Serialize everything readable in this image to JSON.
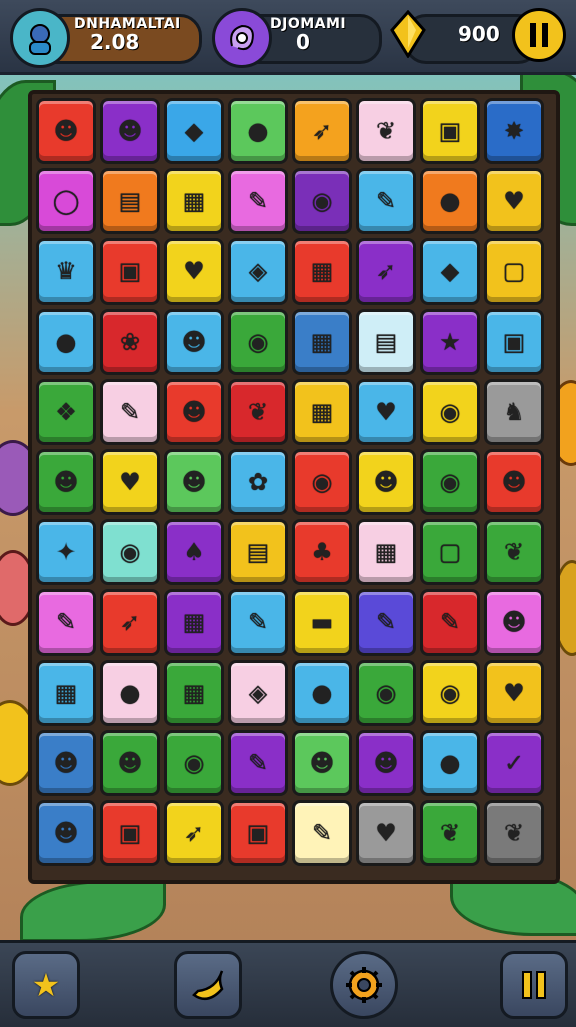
{
  "hud": {
    "player1": {
      "title": "DNHAMALTAI",
      "value": "2.08",
      "avatar_icon": "character-portrait-icon"
    },
    "player2": {
      "title": "DJOMAMI",
      "value": "0",
      "avatar_icon": "purple-creature-icon"
    },
    "currency": {
      "icon": "gold-gem-icon",
      "value": "900"
    },
    "pause_icon": "pause-icon"
  },
  "board": {
    "rows": 11,
    "cols": 8,
    "tiles": [
      [
        {
          "c": "#e83a2c",
          "i": "☻"
        },
        {
          "c": "#8a2fc8",
          "i": "☻"
        },
        {
          "c": "#3aa7e8",
          "i": "◆"
        },
        {
          "c": "#5cc85c",
          "i": "●"
        },
        {
          "c": "#f4a21e",
          "i": "➶"
        },
        {
          "c": "#f7cfe3",
          "i": "❦"
        },
        {
          "c": "#f2d31c",
          "i": "▣"
        },
        {
          "c": "#2a6cc8",
          "i": "✸"
        }
      ],
      [
        {
          "c": "#d84ad8",
          "i": "◯"
        },
        {
          "c": "#f07a1e",
          "i": "▤"
        },
        {
          "c": "#f2d31c",
          "i": "▦"
        },
        {
          "c": "#e86ae0",
          "i": "✎"
        },
        {
          "c": "#7a2fb8",
          "i": "◉"
        },
        {
          "c": "#4ab6e8",
          "i": "✎"
        },
        {
          "c": "#f07a1e",
          "i": "●"
        },
        {
          "c": "#f2c21c",
          "i": "♥"
        }
      ],
      [
        {
          "c": "#4ab6e8",
          "i": "♛"
        },
        {
          "c": "#e83a2c",
          "i": "▣"
        },
        {
          "c": "#f2d31c",
          "i": "♥"
        },
        {
          "c": "#4ab6e8",
          "i": "◈"
        },
        {
          "c": "#e83a2c",
          "i": "▦"
        },
        {
          "c": "#8a2fc8",
          "i": "➶"
        },
        {
          "c": "#4ab6e8",
          "i": "◆"
        },
        {
          "c": "#f2c21c",
          "i": "▢"
        }
      ],
      [
        {
          "c": "#4ab6e8",
          "i": "●"
        },
        {
          "c": "#d8282c",
          "i": "❀"
        },
        {
          "c": "#4ab6e8",
          "i": "☻"
        },
        {
          "c": "#3aa83a",
          "i": "◉"
        },
        {
          "c": "#3a7ec8",
          "i": "▦"
        },
        {
          "c": "#cfeef7",
          "i": "▤"
        },
        {
          "c": "#8a2fc8",
          "i": "★"
        },
        {
          "c": "#4ab6e8",
          "i": "▣"
        }
      ],
      [
        {
          "c": "#3aa83a",
          "i": "❖"
        },
        {
          "c": "#f7cfe3",
          "i": "✎"
        },
        {
          "c": "#e83a2c",
          "i": "☻"
        },
        {
          "c": "#d8282c",
          "i": "❦"
        },
        {
          "c": "#f2c21c",
          "i": "▦"
        },
        {
          "c": "#4ab6e8",
          "i": "♥"
        },
        {
          "c": "#f2d31c",
          "i": "◉"
        },
        {
          "c": "#9a9a9a",
          "i": "♞"
        }
      ],
      [
        {
          "c": "#3aa83a",
          "i": "☻"
        },
        {
          "c": "#f2d31c",
          "i": "♥"
        },
        {
          "c": "#5cc85c",
          "i": "☻"
        },
        {
          "c": "#4ab6e8",
          "i": "✿"
        },
        {
          "c": "#e83a2c",
          "i": "◉"
        },
        {
          "c": "#f2d31c",
          "i": "☻"
        },
        {
          "c": "#3aa83a",
          "i": "◉"
        },
        {
          "c": "#e83a2c",
          "i": "☻"
        }
      ],
      [
        {
          "c": "#4ab6e8",
          "i": "✦"
        },
        {
          "c": "#7fe0d0",
          "i": "◉"
        },
        {
          "c": "#8a2fc8",
          "i": "♠"
        },
        {
          "c": "#f2c21c",
          "i": "▤"
        },
        {
          "c": "#e83a2c",
          "i": "♣"
        },
        {
          "c": "#f7cfe3",
          "i": "▦"
        },
        {
          "c": "#3aa83a",
          "i": "▢"
        },
        {
          "c": "#3aa83a",
          "i": "❦"
        }
      ],
      [
        {
          "c": "#e86ae0",
          "i": "✎"
        },
        {
          "c": "#e83a2c",
          "i": "➶"
        },
        {
          "c": "#8a2fc8",
          "i": "▦"
        },
        {
          "c": "#4ab6e8",
          "i": "✎"
        },
        {
          "c": "#f2d31c",
          "i": "▬"
        },
        {
          "c": "#5a4ad8",
          "i": "✎"
        },
        {
          "c": "#d8282c",
          "i": "✎"
        },
        {
          "c": "#e86ae0",
          "i": "☻"
        }
      ],
      [
        {
          "c": "#4ab6e8",
          "i": "▦"
        },
        {
          "c": "#f7cfe3",
          "i": "●"
        },
        {
          "c": "#3aa83a",
          "i": "▦"
        },
        {
          "c": "#f7cfe3",
          "i": "◈"
        },
        {
          "c": "#4ab6e8",
          "i": "●"
        },
        {
          "c": "#3aa83a",
          "i": "◉"
        },
        {
          "c": "#f2d31c",
          "i": "◉"
        },
        {
          "c": "#f2c21c",
          "i": "♥"
        }
      ],
      [
        {
          "c": "#3a7ec8",
          "i": "☻"
        },
        {
          "c": "#3aa83a",
          "i": "☻"
        },
        {
          "c": "#3aa83a",
          "i": "◉"
        },
        {
          "c": "#8a2fc8",
          "i": "✎"
        },
        {
          "c": "#5cc85c",
          "i": "☻"
        },
        {
          "c": "#8a2fc8",
          "i": "☻"
        },
        {
          "c": "#4ab6e8",
          "i": "●"
        },
        {
          "c": "#8a2fc8",
          "i": "✓"
        }
      ],
      [
        {
          "c": "#3a7ec8",
          "i": "☻"
        },
        {
          "c": "#e83a2c",
          "i": "▣"
        },
        {
          "c": "#f2d31c",
          "i": "➶"
        },
        {
          "c": "#e83a2c",
          "i": "▣"
        },
        {
          "c": "#fff3b8",
          "i": "✎"
        },
        {
          "c": "#9a9a9a",
          "i": "♥"
        },
        {
          "c": "#3aa83a",
          "i": "❦"
        },
        {
          "c": "#7a7a7a",
          "i": "❦"
        }
      ]
    ]
  },
  "bottom_bar": {
    "star_icon": "star-icon",
    "banana_icon": "banana-icon",
    "gear_icon": "gear-icon",
    "pause_icon": "pause-icon"
  }
}
